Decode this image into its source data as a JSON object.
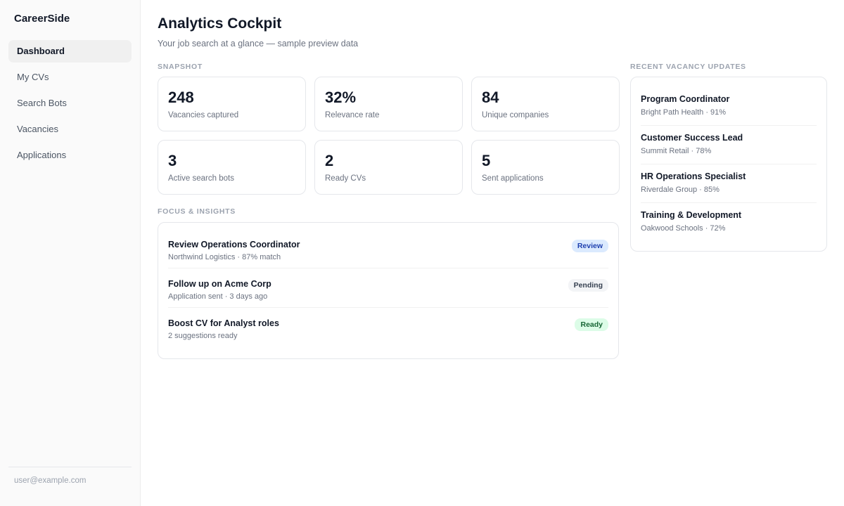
{
  "app": {
    "brand": "CareerSide"
  },
  "sidebar": {
    "items": [
      {
        "label": "Dashboard"
      },
      {
        "label": "My CVs"
      },
      {
        "label": "Search Bots"
      },
      {
        "label": "Vacancies"
      },
      {
        "label": "Applications"
      }
    ],
    "active": "Dashboard",
    "user_email": "user@example.com"
  },
  "header": {
    "title": "Analytics Cockpit",
    "subtitle": "Your job search at a glance — sample preview data"
  },
  "snapshot": {
    "label": "SNAPSHOT",
    "stats": [
      {
        "value": "248",
        "label": "Vacancies captured"
      },
      {
        "value": "32%",
        "label": "Relevance rate"
      },
      {
        "value": "84",
        "label": "Unique companies"
      },
      {
        "value": "3",
        "label": "Active search bots"
      },
      {
        "value": "2",
        "label": "Ready CVs"
      },
      {
        "value": "5",
        "label": "Sent applications"
      }
    ]
  },
  "focus": {
    "label": "FOCUS & INSIGHTS",
    "items": [
      {
        "title": "Review Operations Coordinator",
        "subtitle": "Northwind Logistics · 87% match",
        "badge": "Review"
      },
      {
        "title": "Follow up on Acme Corp",
        "subtitle": "Application sent · 3 days ago",
        "badge": "Pending"
      },
      {
        "title": "Boost CV for Analyst roles",
        "subtitle": "2 suggestions ready",
        "badge": "Ready"
      }
    ]
  },
  "vacancies": {
    "label": "RECENT VACANCY UPDATES",
    "items": [
      {
        "title": "Program Coordinator",
        "subtitle": "Bright Path Health · 91%"
      },
      {
        "title": "Customer Success Lead",
        "subtitle": "Summit Retail · 78%"
      },
      {
        "title": "HR Operations Specialist",
        "subtitle": "Riverdale Group · 85%"
      },
      {
        "title": "Training & Development",
        "subtitle": "Oakwood Schools · 72%"
      }
    ]
  },
  "colors": {
    "review_badge_bg": "#dbeafe",
    "pending_badge_bg": "#f3f4f6",
    "ready_badge_bg": "#dcfce7"
  }
}
